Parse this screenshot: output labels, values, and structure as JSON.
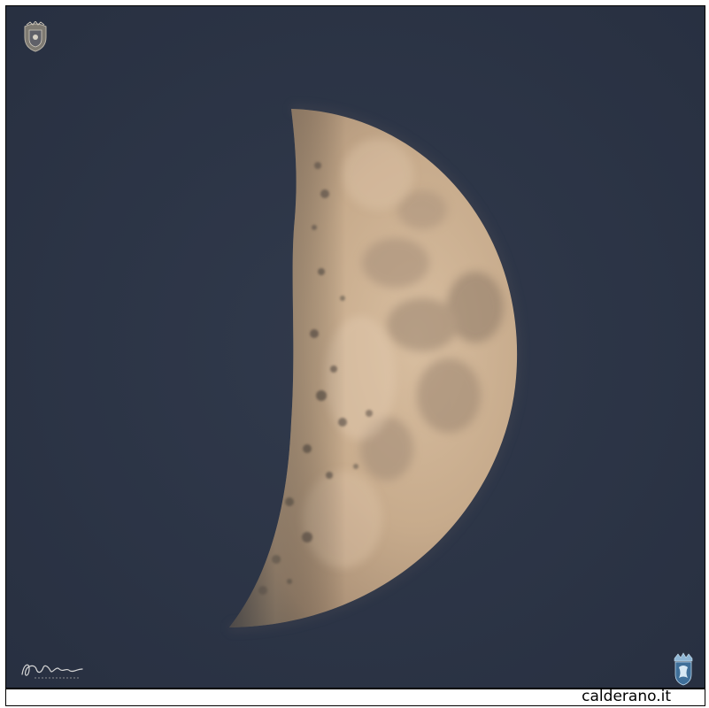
{
  "photo": {
    "subject": "moon",
    "sky_color": "#2c3445",
    "moon_color": "#c8ad8f"
  },
  "crest": {
    "icon": "coat-of-arms-icon"
  },
  "signature": {
    "icon": "handwritten-signature-icon"
  },
  "bottom_logo": {
    "icon": "crown-crest-icon"
  },
  "footer": {
    "site": "calderano.it"
  }
}
